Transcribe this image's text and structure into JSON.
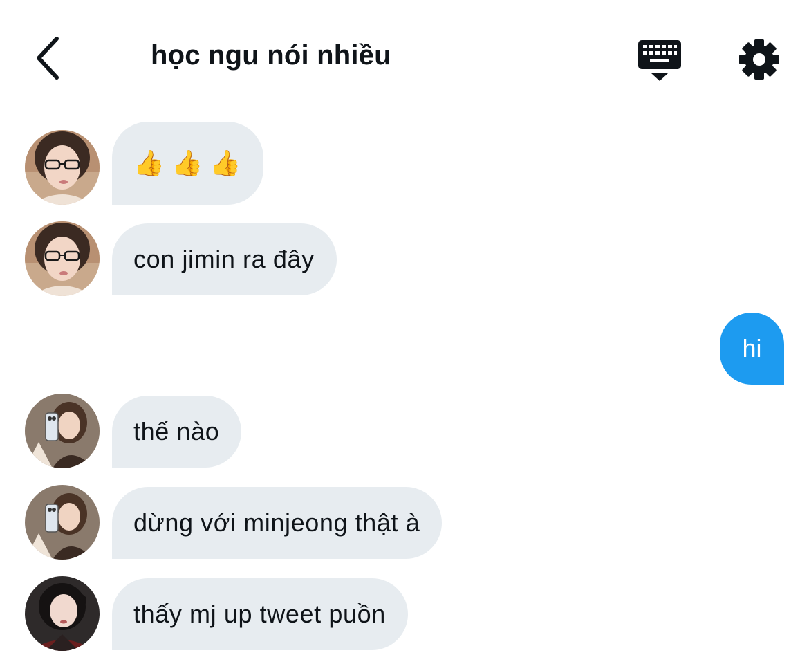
{
  "header": {
    "title": "học ngu nói nhiều",
    "back_icon": "chevron-left-icon",
    "keyboard_icon": "keyboard-icon",
    "settings_icon": "gear-icon"
  },
  "messages": [
    {
      "direction": "incoming",
      "sender_avatar": "avatar-girl-glasses",
      "text": "👍👍👍"
    },
    {
      "direction": "incoming",
      "sender_avatar": "avatar-girl-glasses",
      "text": "con jimin ra đây"
    },
    {
      "direction": "outgoing",
      "text": "hi"
    },
    {
      "direction": "incoming",
      "sender_avatar": "avatar-girl-mirror-selfie",
      "text": "thế nào"
    },
    {
      "direction": "incoming",
      "sender_avatar": "avatar-girl-mirror-selfie",
      "text": "dừng với minjeong thật à"
    },
    {
      "direction": "incoming",
      "sender_avatar": "avatar-girl-short-hair",
      "text": "thấy mj up tweet puồn"
    }
  ],
  "colors": {
    "incoming_bubble": "#e7ecf0",
    "outgoing_bubble": "#1d9bf0",
    "text": "#0f1419"
  }
}
